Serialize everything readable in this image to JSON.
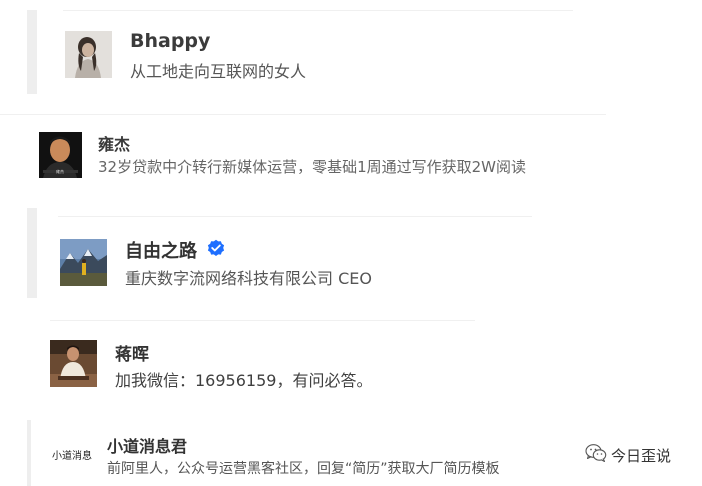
{
  "cards": [
    {
      "name": "Bhappy",
      "description": "从工地走向互联网的女人",
      "avatar": "woman-portrait-icon"
    },
    {
      "name": "雍杰",
      "description": "32岁贷款中介转行新媒体运营，零基础1周通过写作获取2W阅读",
      "avatar": "man-portrait-icon"
    },
    {
      "name": "自由之路",
      "description": "重庆数字流网络科技有限公司 CEO",
      "avatar": "mountain-landscape-icon",
      "verified": true,
      "verified_color": "#1e6fff"
    },
    {
      "name": "蒋晖",
      "description": "加我微信：16956159，有问必答。",
      "avatar": "man-seated-portrait-icon"
    },
    {
      "name": "小道消息君",
      "description": "前阿里人，公众号运营黑客社区，回复“简历”获取大厂简历模板",
      "avatar": "calligraphy-logo-icon",
      "avatar_text": "小道消息"
    }
  ],
  "watermark": {
    "text": "今日歪说",
    "icon": "wechat-icon"
  }
}
